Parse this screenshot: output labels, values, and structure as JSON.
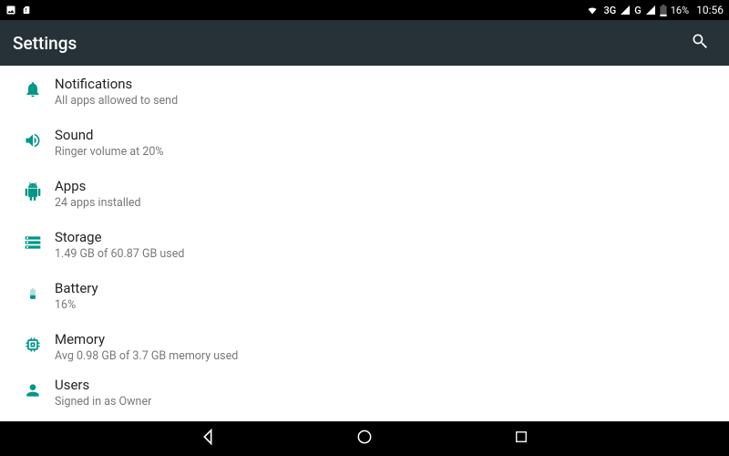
{
  "status_bar": {
    "network_label": "3G",
    "network_label_2": "G",
    "battery_pct": "16%",
    "time": "10:56"
  },
  "header": {
    "title": "Settings"
  },
  "items": [
    {
      "title": "Notifications",
      "subtitle": "All apps allowed to send",
      "icon": "bell"
    },
    {
      "title": "Sound",
      "subtitle": "Ringer volume at 20%",
      "icon": "volume"
    },
    {
      "title": "Apps",
      "subtitle": "24 apps installed",
      "icon": "android"
    },
    {
      "title": "Storage",
      "subtitle": "1.49 GB of 60.87 GB used",
      "icon": "storage"
    },
    {
      "title": "Battery",
      "subtitle": "16%",
      "icon": "battery"
    },
    {
      "title": "Memory",
      "subtitle": "Avg 0.98 GB of 3.7 GB memory used",
      "icon": "memory"
    },
    {
      "title": "Users",
      "subtitle": "Signed in as Owner",
      "icon": "person"
    }
  ],
  "colors": {
    "accent": "#009688",
    "appbar": "#263238"
  }
}
